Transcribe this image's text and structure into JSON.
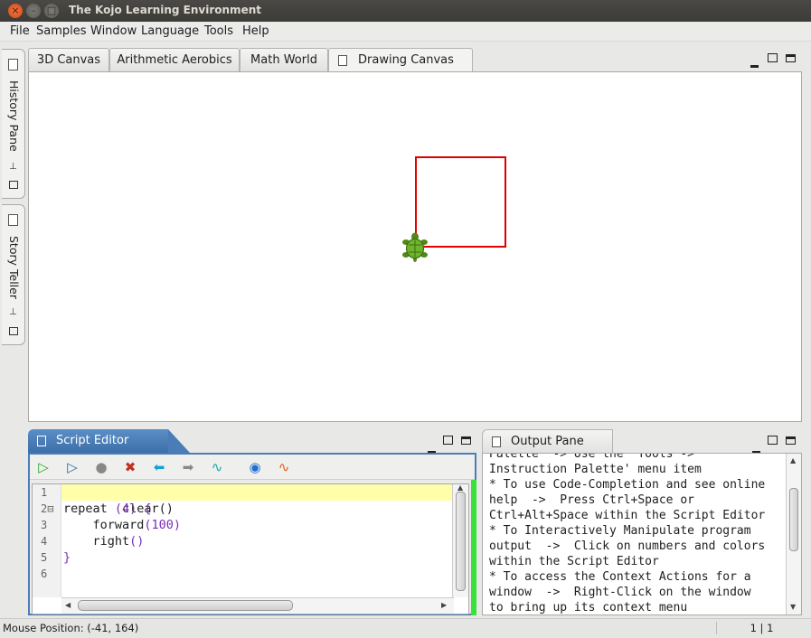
{
  "window": {
    "title": "The Kojo Learning Environment",
    "close": "×",
    "minimize": "–",
    "maximize": "□"
  },
  "menu": [
    "File",
    "Samples",
    "Window",
    "Language",
    "Tools",
    "Help"
  ],
  "side_tabs": [
    {
      "label": "History Pane"
    },
    {
      "label": "Story Teller"
    }
  ],
  "canvas_tabs": [
    "3D Canvas",
    "Arithmetic Aerobics",
    "Math World",
    "Drawing Canvas"
  ],
  "script_editor": {
    "tab_label": "Script Editor",
    "toolbar": [
      "run-icon",
      "run-worksheet-icon",
      "stop-icon",
      "clear-icon",
      "back-icon",
      "forward-icon",
      "format-icon",
      "help-icon",
      "scala-icon"
    ],
    "line_numbers": [
      "1",
      "2⊟",
      "3",
      "4",
      "5",
      "6"
    ],
    "code_lines": [
      [
        {
          "t": "clear()",
          "c": "plain"
        }
      ],
      [
        {
          "t": "repeat ",
          "c": "plain"
        },
        {
          "t": "(4)",
          "c": "num"
        },
        {
          "t": " {",
          "c": "num"
        }
      ],
      [
        {
          "t": "    forward",
          "c": "plain"
        },
        {
          "t": "(100)",
          "c": "num"
        }
      ],
      [
        {
          "t": "    right",
          "c": "plain"
        },
        {
          "t": "()",
          "c": "num"
        }
      ],
      [
        {
          "t": "}",
          "c": "num"
        }
      ],
      [
        {
          "t": "",
          "c": "plain"
        }
      ]
    ]
  },
  "output_pane": {
    "tab_label": "Output Pane",
    "text": "Palette' -> Use the 'Tools ->\nInstruction Palette' menu item\n* To use Code-Completion and see online\nhelp  ->  Press Ctrl+Space or\nCtrl+Alt+Space within the Script Editor\n* To Interactively Manipulate program\noutput  ->  Click on numbers and colors\nwithin the Script Editor\n* To access the Context Actions for a\nwindow  ->  Right-Click on the window\nto bring up its context menu"
  },
  "status": {
    "mouse_position": "Mouse Position: (-41, 164)",
    "caret": "1 | 1"
  },
  "colors": {
    "accent": "#4a7db7",
    "square_stroke": "#e00000",
    "highlight_line": "#ffffaa"
  }
}
